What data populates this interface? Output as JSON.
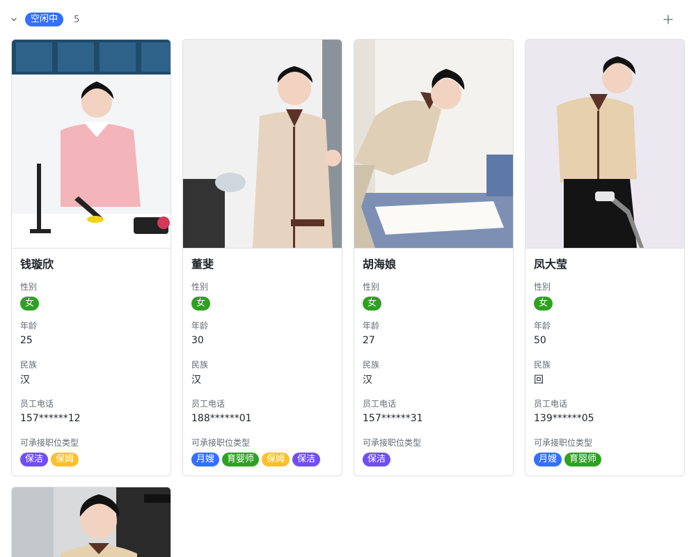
{
  "group": {
    "status_label": "空闲中",
    "count": "5",
    "colors": {
      "status": "#3370ff"
    },
    "icons": {
      "collapse": "chevron-down-icon",
      "add": "plus-icon"
    }
  },
  "field_labels": {
    "gender": "性别",
    "age": "年龄",
    "ethnicity": "民族",
    "phone": "员工电话",
    "job_types": "可承接职位类型"
  },
  "tag_colors": {
    "女": "#2ea121",
    "保洁": "#6f4ef2",
    "保姆": "#fdc02b",
    "月嫂": "#3370ff",
    "育婴师": "#2ea121"
  },
  "cards": [
    {
      "name": "钱璇欣",
      "gender": "女",
      "age": "25",
      "ethnicity": "汉",
      "phone": "157******12",
      "job_types": [
        "保洁",
        "保姆"
      ]
    },
    {
      "name": "董斐",
      "gender": "女",
      "age": "30",
      "ethnicity": "汉",
      "phone": "188******01",
      "job_types": [
        "月嫂",
        "育婴师",
        "保姆",
        "保洁"
      ]
    },
    {
      "name": "胡海娘",
      "gender": "女",
      "age": "27",
      "ethnicity": "汉",
      "phone": "157******31",
      "job_types": [
        "保洁"
      ]
    },
    {
      "name": "凤大莹",
      "gender": "女",
      "age": "50",
      "ethnicity": "回",
      "phone": "139******05",
      "job_types": [
        "月嫂",
        "育婴师"
      ]
    }
  ]
}
